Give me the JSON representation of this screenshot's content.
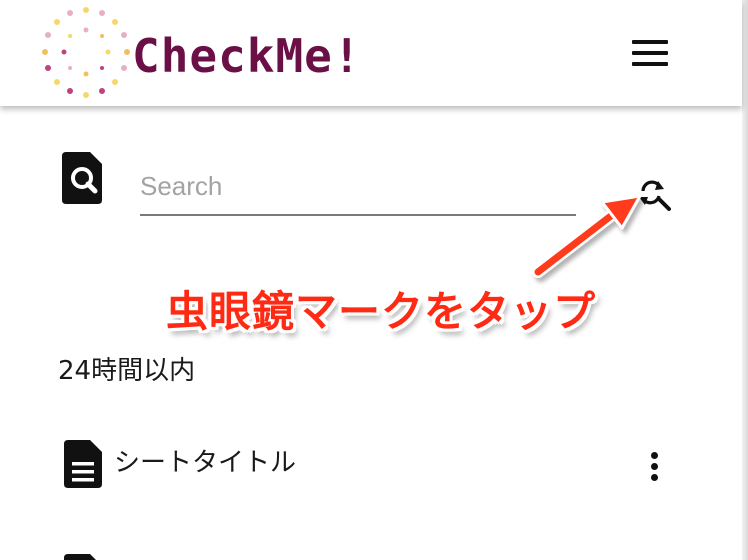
{
  "header": {
    "logo_text": "CheckMe!",
    "logo_icon": "dotted-circle-logo",
    "menu_icon": "hamburger-menu-icon",
    "brand_color": "#6a1046"
  },
  "search": {
    "placeholder": "Search",
    "value": "",
    "left_icon": "document-search-icon",
    "action_icon": "refresh-search-icon"
  },
  "callout": {
    "text": "虫眼鏡マークをタップ",
    "color": "#ff2a14"
  },
  "section": {
    "heading": "24時間以内"
  },
  "sheets": [
    {
      "title": "シートタイトル",
      "icon": "document-icon",
      "menu_icon": "more-vertical-icon"
    }
  ]
}
